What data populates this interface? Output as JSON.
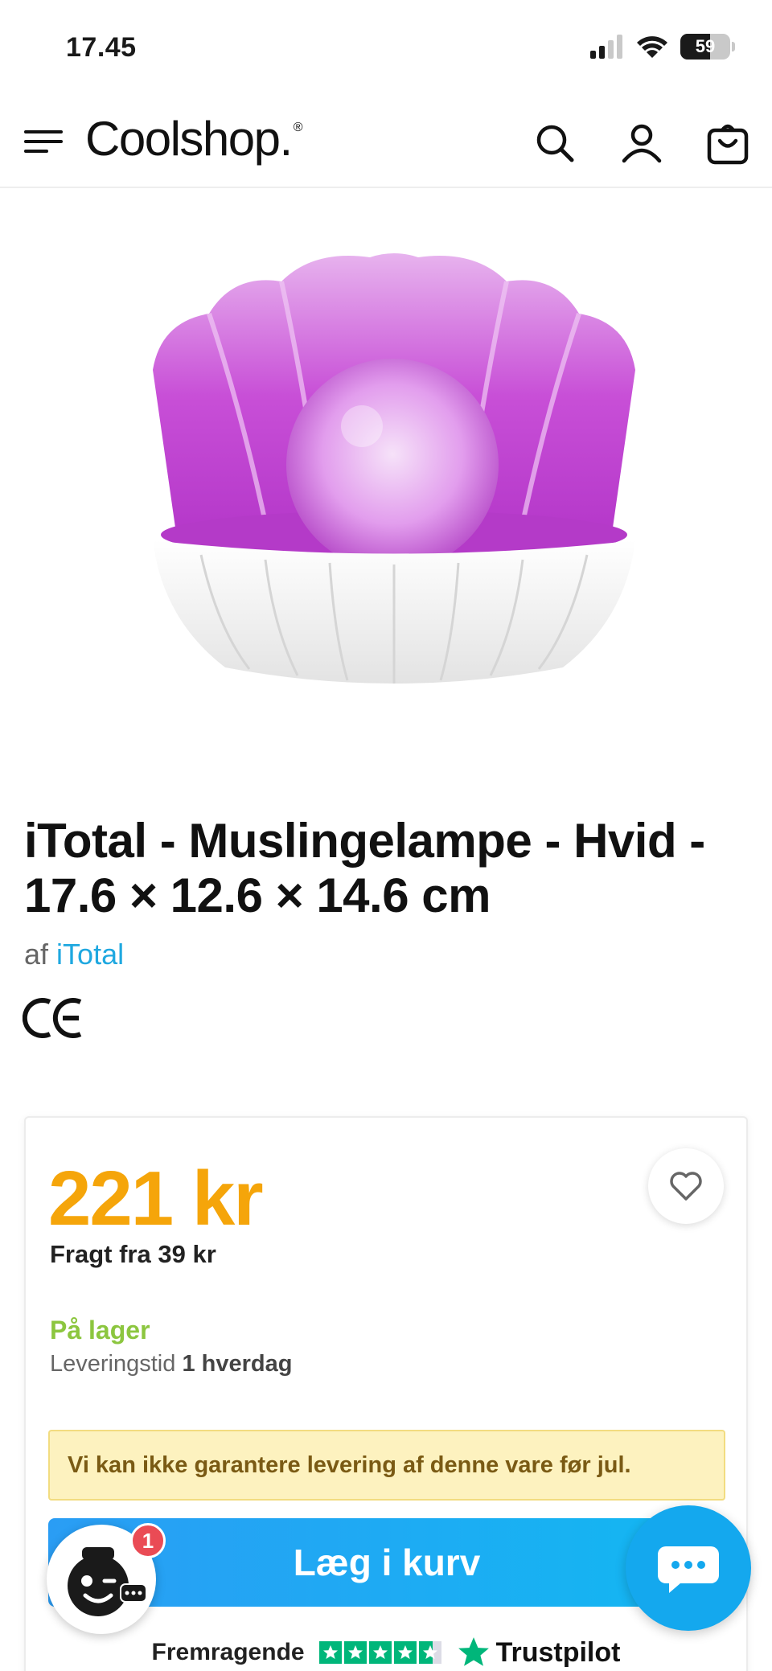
{
  "status_bar": {
    "time": "17.45",
    "battery_level": "59"
  },
  "header": {
    "logo_text": "Coolshop.",
    "logo_mark": "®",
    "icons": [
      "menu-icon",
      "search-icon",
      "user-icon",
      "cart-icon"
    ]
  },
  "product": {
    "title": "iTotal - Muslingelampe - Hvid - 17.6 × 12.6 × 14.6 cm",
    "brand_prefix": "af",
    "brand_name": "iTotal",
    "certification_mark": "CE"
  },
  "purchase": {
    "price": "221 kr",
    "shipping": "Fragt fra 39 kr",
    "stock_status": "På lager",
    "delivery_label": "Leveringstid",
    "delivery_time": "1 hverdag",
    "notice": "Vi kan ikke garantere levering af denne vare før jul.",
    "add_to_cart_label": "Læg i kurv"
  },
  "trustpilot": {
    "rating_label": "Fremragende",
    "brand": "Trustpilot"
  },
  "widgets": {
    "assistant_badge_count": "1"
  },
  "colors": {
    "price": "#f5a50a",
    "in_stock": "#8cc63f",
    "brand_link": "#1fa8e0",
    "add_to_cart": "#2a9df4",
    "trustpilot_green": "#00b67a",
    "notice_bg": "#fdf2bf"
  }
}
